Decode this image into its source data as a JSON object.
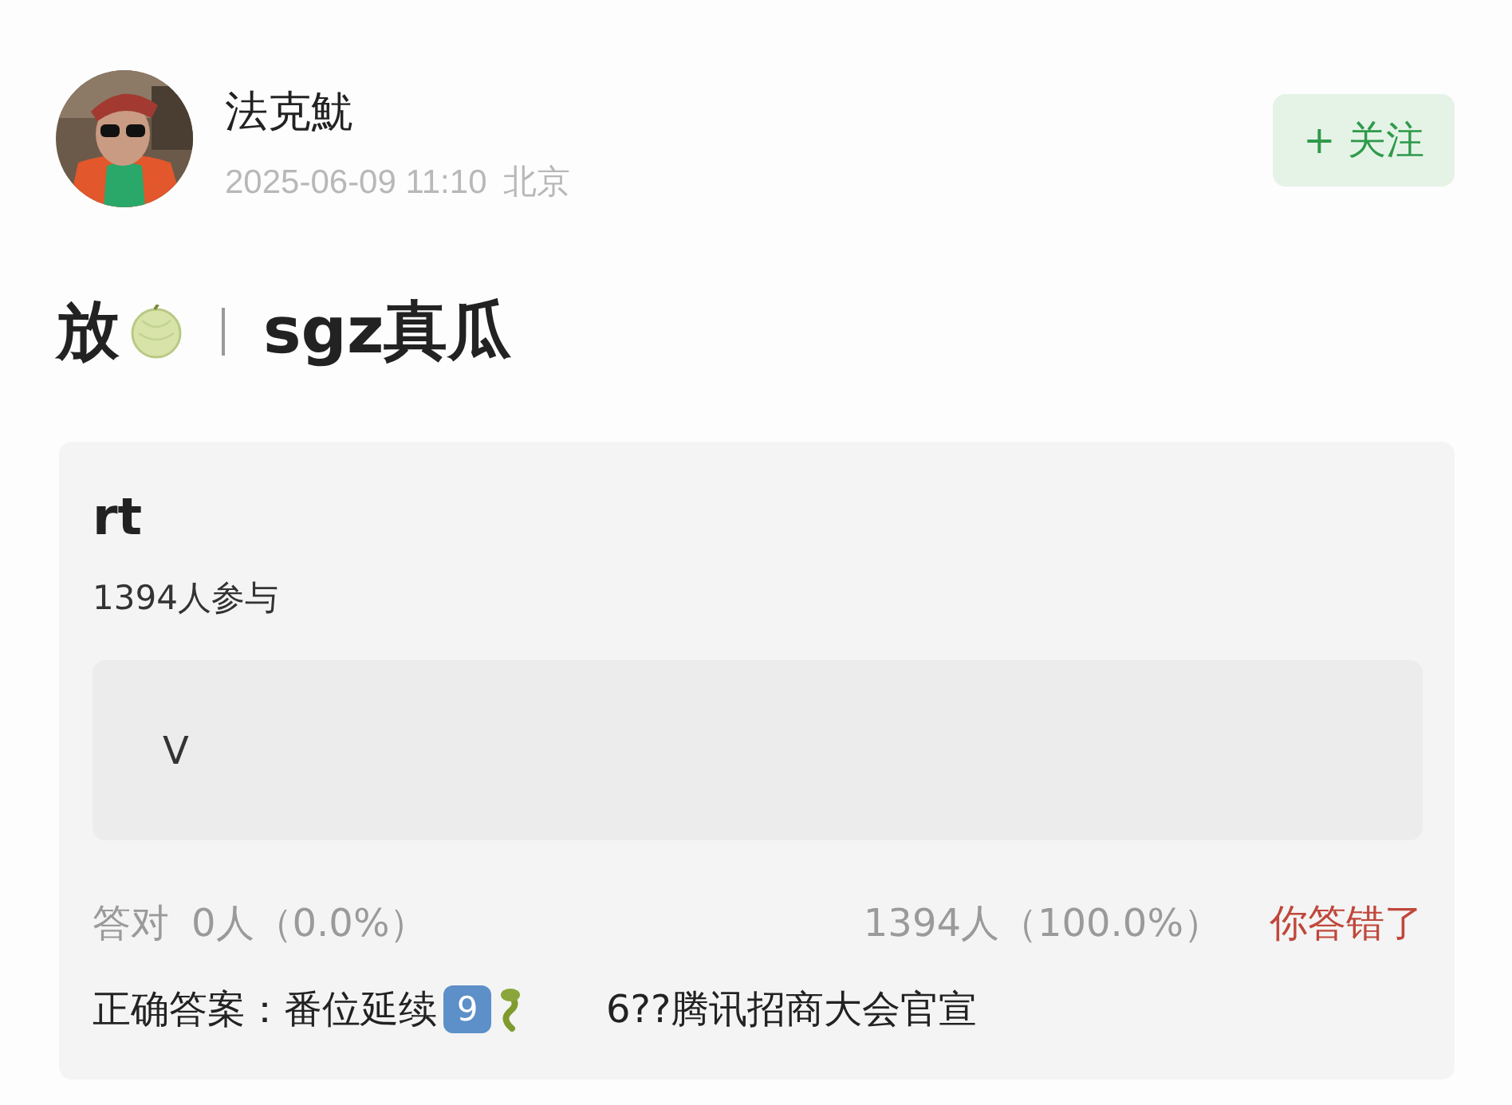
{
  "author": {
    "name": "法克魷",
    "time": "2025-06-09 11:10",
    "location": "北京"
  },
  "follow_button": {
    "label": "+ 关注"
  },
  "title": {
    "before": "放",
    "after": "sgz真瓜"
  },
  "quiz": {
    "question": "rt",
    "participants": "1394人参与",
    "options": [
      {
        "label": "V"
      }
    ],
    "correct_label": "答对",
    "correct_stat": "0人（0.0%）",
    "wrong_stat": "1394人（100.0%）",
    "result": "你答错了",
    "answer_label": "正确答案：",
    "answer_text": "番位延续",
    "answer_badge": "9",
    "answer_tail": "6??腾讯招商大会官宣"
  }
}
